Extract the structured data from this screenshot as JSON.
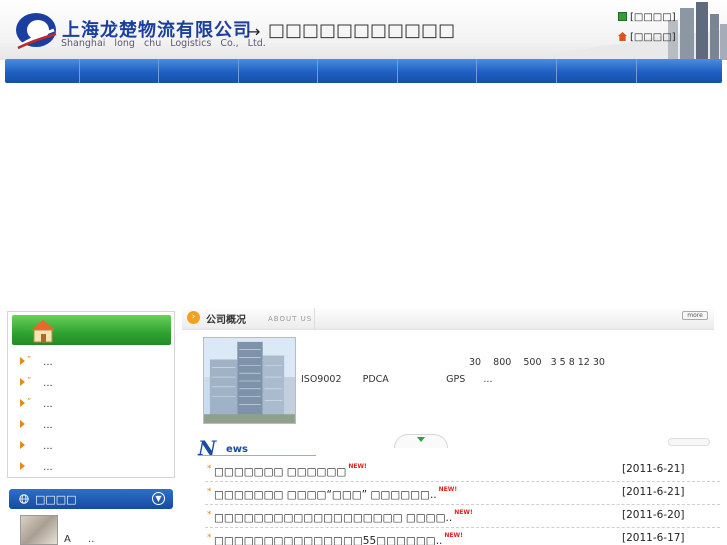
{
  "header": {
    "company_name_cn": "上海龙楚物流有限公司",
    "company_name_en": "Shanghai long chu  Logistics   Co., Ltd.",
    "arrow": "→",
    "slogan": "□□□□□□□□□□□",
    "quick_links": [
      {
        "label": "[□□□□]",
        "icon": "bookmark-icon",
        "color": "#3a9a3a"
      },
      {
        "label": "[□□□□]",
        "icon": "home-icon",
        "color": "#d8551f"
      }
    ]
  },
  "nav": {
    "item_count": 9
  },
  "sidebar": {
    "items": [
      {
        "label": "..."
      },
      {
        "label": "..."
      },
      {
        "label": "..."
      },
      {
        "label": "..."
      },
      {
        "label": "..."
      },
      {
        "label": "..."
      }
    ],
    "customer_service": {
      "title": "□□□□",
      "text": "A ..",
      "toggle": "▼"
    }
  },
  "about": {
    "title": "公司概况",
    "subtitle": "ABOUT US",
    "more": "more",
    "text_line_1": "30    800    500   3 5 8 12 30",
    "text_line_2": "ISO9002       PDCA                   GPS      ..."
  },
  "news": {
    "title_letters": "ews",
    "items": [
      {
        "title": "□□□□□□□ □□□□□□",
        "date": "[2011-6-21]"
      },
      {
        "title": "□□□□□□□ □□□□“□□□” □□□□□□..",
        "date": "[2011-6-21]"
      },
      {
        "title": "□□□□□□□□□□□□□□□□□□□ □□□□..",
        "date": "[2011-6-20]"
      },
      {
        "title": "□□□□□□□□□□□□□□□55□□□□□□..",
        "date": "[2011-6-17]"
      }
    ],
    "new_badge": "NEW!"
  },
  "colors": {
    "brand_blue": "#1b3f9e",
    "nav_blue": "#1f5fc1",
    "sidebar_green": "#2fa331",
    "accent_orange": "#e48a1c"
  }
}
